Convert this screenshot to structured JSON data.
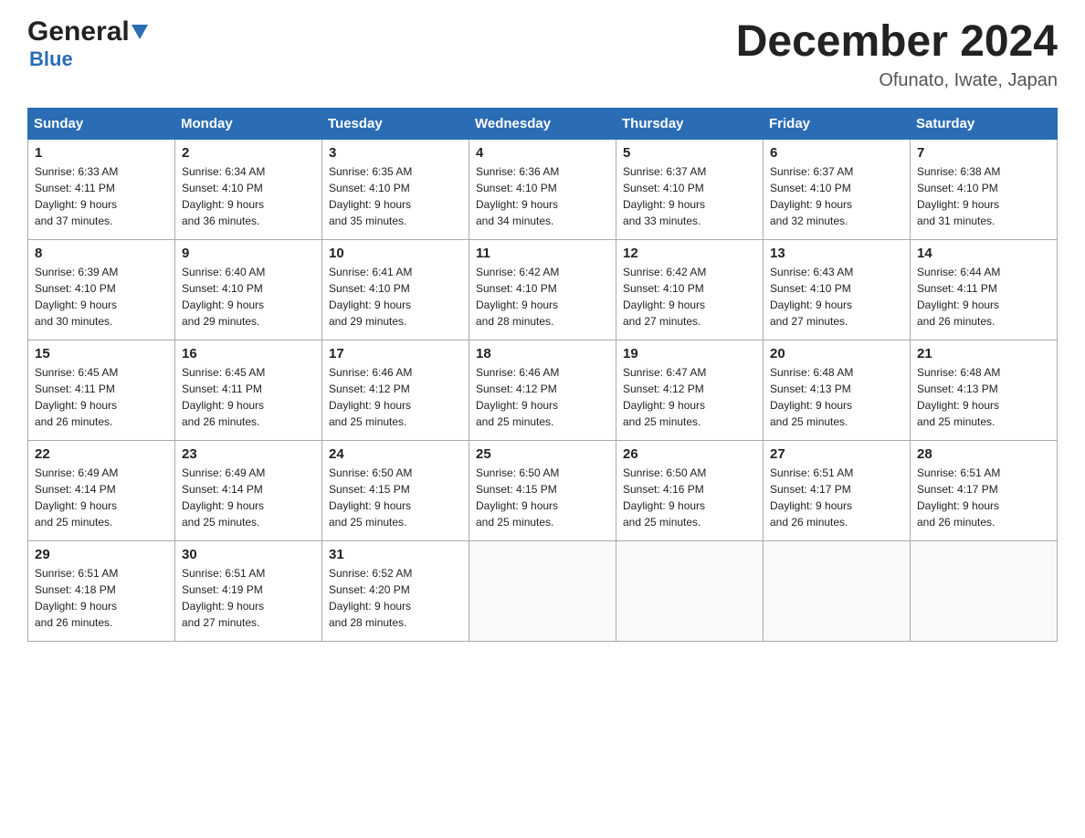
{
  "header": {
    "logo_general": "General",
    "logo_blue": "Blue",
    "month_title": "December 2024",
    "location": "Ofunato, Iwate, Japan"
  },
  "days_of_week": [
    "Sunday",
    "Monday",
    "Tuesday",
    "Wednesday",
    "Thursday",
    "Friday",
    "Saturday"
  ],
  "weeks": [
    [
      {
        "day": "1",
        "sunrise": "6:33 AM",
        "sunset": "4:11 PM",
        "daylight": "9 hours and 37 minutes."
      },
      {
        "day": "2",
        "sunrise": "6:34 AM",
        "sunset": "4:10 PM",
        "daylight": "9 hours and 36 minutes."
      },
      {
        "day": "3",
        "sunrise": "6:35 AM",
        "sunset": "4:10 PM",
        "daylight": "9 hours and 35 minutes."
      },
      {
        "day": "4",
        "sunrise": "6:36 AM",
        "sunset": "4:10 PM",
        "daylight": "9 hours and 34 minutes."
      },
      {
        "day": "5",
        "sunrise": "6:37 AM",
        "sunset": "4:10 PM",
        "daylight": "9 hours and 33 minutes."
      },
      {
        "day": "6",
        "sunrise": "6:37 AM",
        "sunset": "4:10 PM",
        "daylight": "9 hours and 32 minutes."
      },
      {
        "day": "7",
        "sunrise": "6:38 AM",
        "sunset": "4:10 PM",
        "daylight": "9 hours and 31 minutes."
      }
    ],
    [
      {
        "day": "8",
        "sunrise": "6:39 AM",
        "sunset": "4:10 PM",
        "daylight": "9 hours and 30 minutes."
      },
      {
        "day": "9",
        "sunrise": "6:40 AM",
        "sunset": "4:10 PM",
        "daylight": "9 hours and 29 minutes."
      },
      {
        "day": "10",
        "sunrise": "6:41 AM",
        "sunset": "4:10 PM",
        "daylight": "9 hours and 29 minutes."
      },
      {
        "day": "11",
        "sunrise": "6:42 AM",
        "sunset": "4:10 PM",
        "daylight": "9 hours and 28 minutes."
      },
      {
        "day": "12",
        "sunrise": "6:42 AM",
        "sunset": "4:10 PM",
        "daylight": "9 hours and 27 minutes."
      },
      {
        "day": "13",
        "sunrise": "6:43 AM",
        "sunset": "4:10 PM",
        "daylight": "9 hours and 27 minutes."
      },
      {
        "day": "14",
        "sunrise": "6:44 AM",
        "sunset": "4:11 PM",
        "daylight": "9 hours and 26 minutes."
      }
    ],
    [
      {
        "day": "15",
        "sunrise": "6:45 AM",
        "sunset": "4:11 PM",
        "daylight": "9 hours and 26 minutes."
      },
      {
        "day": "16",
        "sunrise": "6:45 AM",
        "sunset": "4:11 PM",
        "daylight": "9 hours and 26 minutes."
      },
      {
        "day": "17",
        "sunrise": "6:46 AM",
        "sunset": "4:12 PM",
        "daylight": "9 hours and 25 minutes."
      },
      {
        "day": "18",
        "sunrise": "6:46 AM",
        "sunset": "4:12 PM",
        "daylight": "9 hours and 25 minutes."
      },
      {
        "day": "19",
        "sunrise": "6:47 AM",
        "sunset": "4:12 PM",
        "daylight": "9 hours and 25 minutes."
      },
      {
        "day": "20",
        "sunrise": "6:48 AM",
        "sunset": "4:13 PM",
        "daylight": "9 hours and 25 minutes."
      },
      {
        "day": "21",
        "sunrise": "6:48 AM",
        "sunset": "4:13 PM",
        "daylight": "9 hours and 25 minutes."
      }
    ],
    [
      {
        "day": "22",
        "sunrise": "6:49 AM",
        "sunset": "4:14 PM",
        "daylight": "9 hours and 25 minutes."
      },
      {
        "day": "23",
        "sunrise": "6:49 AM",
        "sunset": "4:14 PM",
        "daylight": "9 hours and 25 minutes."
      },
      {
        "day": "24",
        "sunrise": "6:50 AM",
        "sunset": "4:15 PM",
        "daylight": "9 hours and 25 minutes."
      },
      {
        "day": "25",
        "sunrise": "6:50 AM",
        "sunset": "4:15 PM",
        "daylight": "9 hours and 25 minutes."
      },
      {
        "day": "26",
        "sunrise": "6:50 AM",
        "sunset": "4:16 PM",
        "daylight": "9 hours and 25 minutes."
      },
      {
        "day": "27",
        "sunrise": "6:51 AM",
        "sunset": "4:17 PM",
        "daylight": "9 hours and 26 minutes."
      },
      {
        "day": "28",
        "sunrise": "6:51 AM",
        "sunset": "4:17 PM",
        "daylight": "9 hours and 26 minutes."
      }
    ],
    [
      {
        "day": "29",
        "sunrise": "6:51 AM",
        "sunset": "4:18 PM",
        "daylight": "9 hours and 26 minutes."
      },
      {
        "day": "30",
        "sunrise": "6:51 AM",
        "sunset": "4:19 PM",
        "daylight": "9 hours and 27 minutes."
      },
      {
        "day": "31",
        "sunrise": "6:52 AM",
        "sunset": "4:20 PM",
        "daylight": "9 hours and 28 minutes."
      },
      null,
      null,
      null,
      null
    ]
  ],
  "labels": {
    "sunrise": "Sunrise:",
    "sunset": "Sunset:",
    "daylight": "Daylight:"
  }
}
